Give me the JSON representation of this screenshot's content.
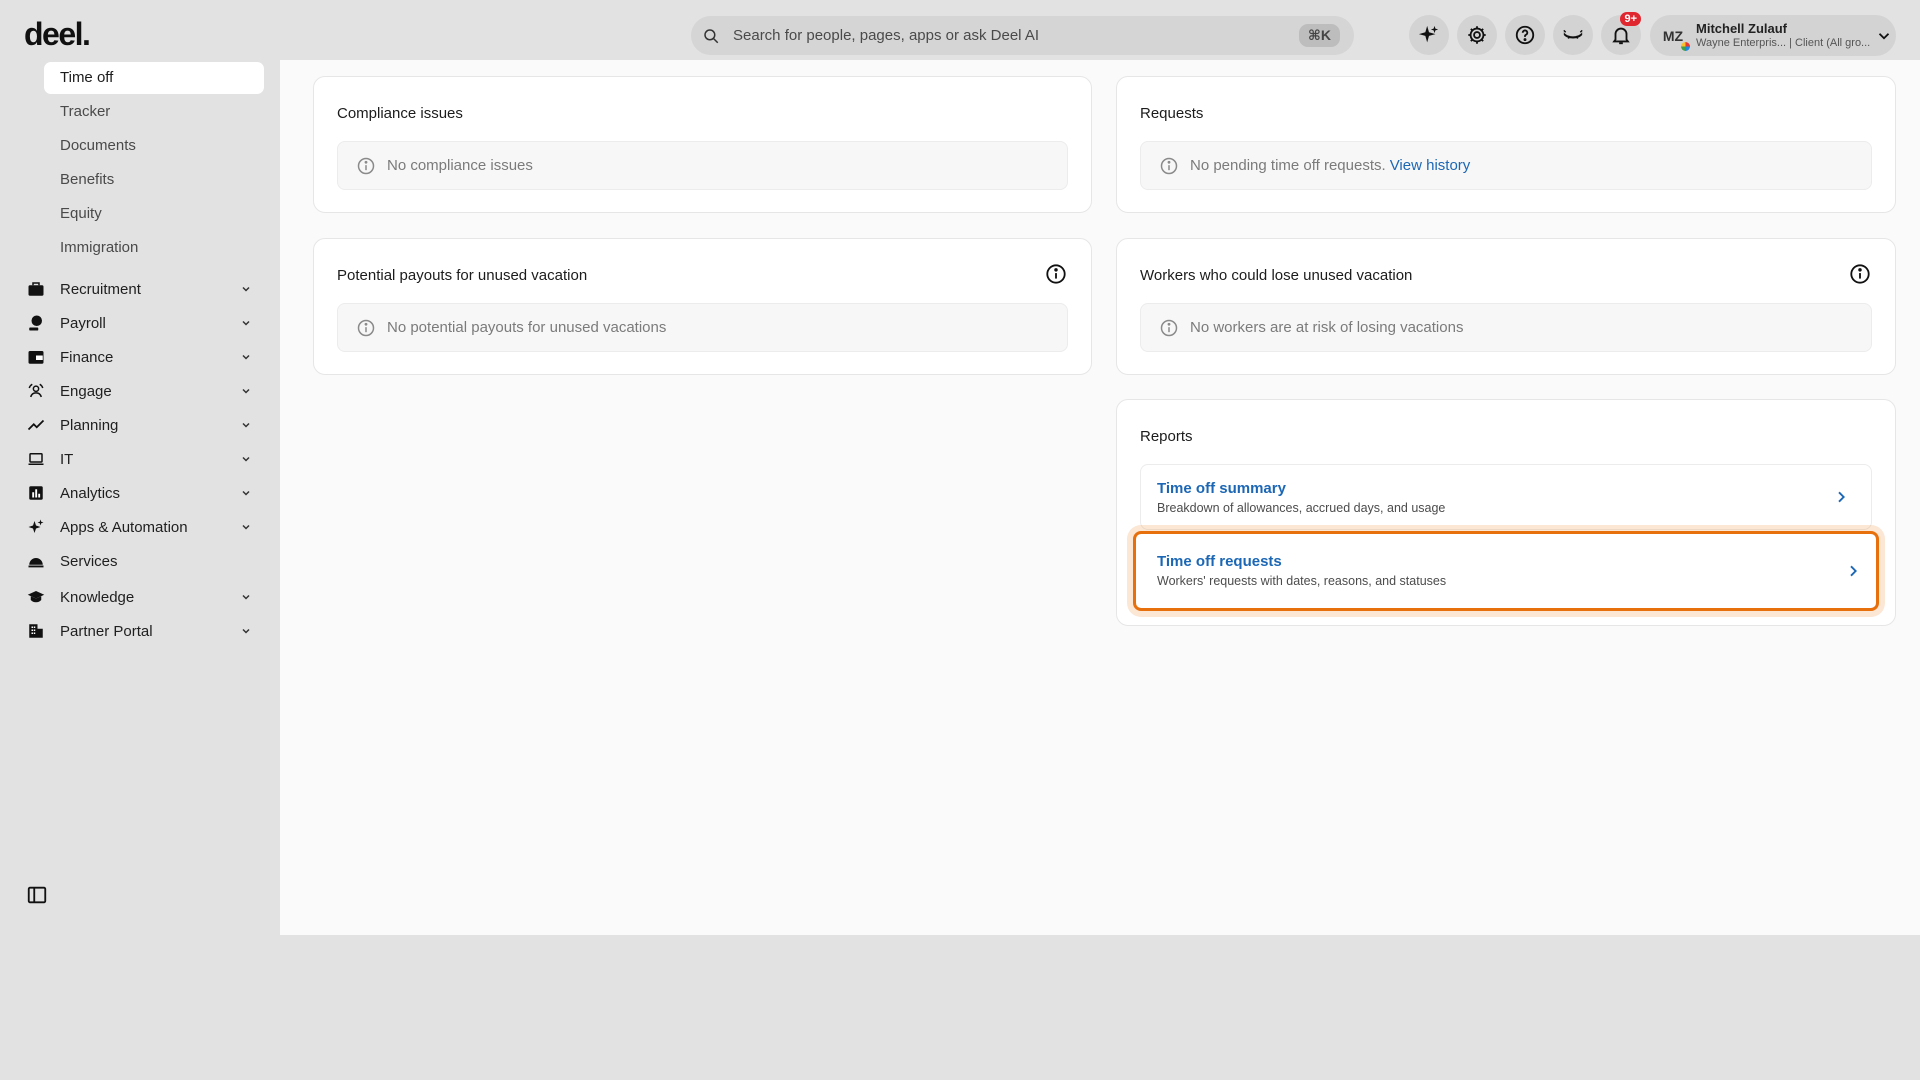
{
  "app": {
    "logo": "deel."
  },
  "search": {
    "placeholder": "Search for people, pages, apps or ask Deel AI",
    "shortcut": "⌘K"
  },
  "topbar": {
    "notifications_badge": "9+"
  },
  "user": {
    "initials": "MZ",
    "name": "Mitchell Zulauf",
    "subtitle": "Wayne Enterpris... | Client (All gro..."
  },
  "sidebar": {
    "sub_items": [
      "Time off",
      "Tracker",
      "Documents",
      "Benefits",
      "Equity",
      "Immigration"
    ],
    "active_sub_item": "Time off",
    "items": [
      {
        "label": "Recruitment",
        "icon": "briefcase-icon"
      },
      {
        "label": "Payroll",
        "icon": "payroll-icon"
      },
      {
        "label": "Finance",
        "icon": "wallet-icon"
      },
      {
        "label": "Engage",
        "icon": "people-icon"
      },
      {
        "label": "Planning",
        "icon": "trend-icon"
      },
      {
        "label": "IT",
        "icon": "laptop-icon"
      },
      {
        "label": "Analytics",
        "icon": "chart-icon"
      },
      {
        "label": "Apps & Automation",
        "icon": "sparkle-icon"
      },
      {
        "label": "Services",
        "icon": "bell-service-icon"
      },
      {
        "label": "Knowledge",
        "icon": "graduation-cap-icon"
      },
      {
        "label": "Partner Portal",
        "icon": "building-icon"
      }
    ]
  },
  "cards": {
    "compliance": {
      "title": "Compliance issues",
      "empty": "No compliance issues"
    },
    "requests": {
      "title": "Requests",
      "empty": "No pending time off requests.",
      "link": "View history"
    },
    "payouts": {
      "title": "Potential payouts for unused vacation",
      "empty": "No potential payouts for unused vacations"
    },
    "workers": {
      "title": "Workers who could lose unused vacation",
      "empty": "No workers are at risk of losing vacations"
    },
    "reports": {
      "title": "Reports",
      "rows": [
        {
          "title": "Time off summary",
          "desc": "Breakdown of allowances, accrued days, and usage"
        },
        {
          "title": "Time off requests",
          "desc": "Workers' requests with dates, reasons, and statuses"
        }
      ]
    }
  },
  "colors": {
    "accent_link": "#1c67b5",
    "highlight": "#e7700d",
    "badge": "#e0262f"
  }
}
